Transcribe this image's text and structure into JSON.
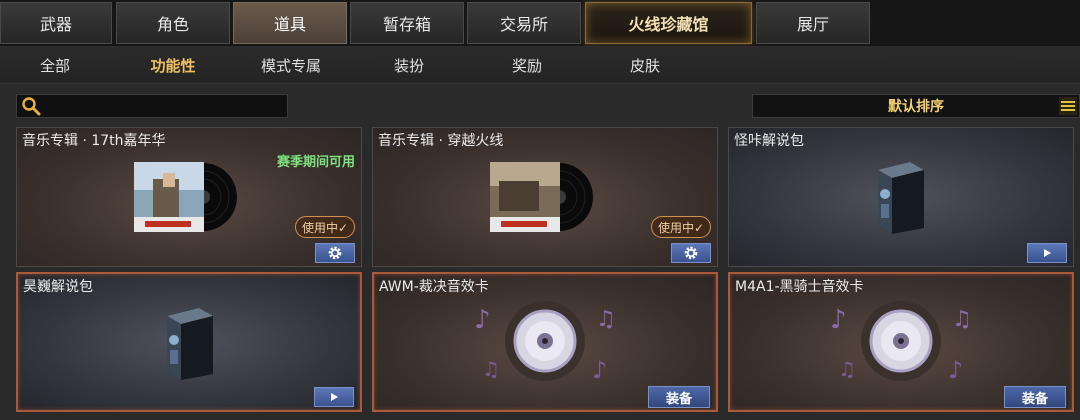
{
  "top_tabs": [
    "武器",
    "角色",
    "道具",
    "暂存箱",
    "交易所",
    "火线珍藏馆",
    "展厅"
  ],
  "sub_tabs": [
    "全部",
    "功能性",
    "模式专属",
    "装扮",
    "奖励",
    "皮肤"
  ],
  "active_top_tab": "道具",
  "active_sub_tab": "功能性",
  "search": {
    "value": ""
  },
  "sort": {
    "label": "默认排序"
  },
  "items": [
    {
      "title": "音乐专辑 · 17th嘉年华",
      "season_label": "赛季期间可用",
      "status": "使用中✓",
      "action": "settings"
    },
    {
      "title": "音乐专辑 · 穿越火线",
      "status": "使用中✓",
      "action": "settings"
    },
    {
      "title": "怪咔解说包",
      "action": "play"
    },
    {
      "title": "昊巍解说包",
      "action": "play"
    },
    {
      "title": "AWM-裁决音效卡",
      "action_label": "装备"
    },
    {
      "title": "M4A1-黑骑士音效卡",
      "action_label": "装备"
    }
  ],
  "colors": {
    "active_sub_tab": "#f0c060",
    "season_label": "#7ee07e",
    "action_button": "#3a5290",
    "sort_label": "#f0d070"
  }
}
